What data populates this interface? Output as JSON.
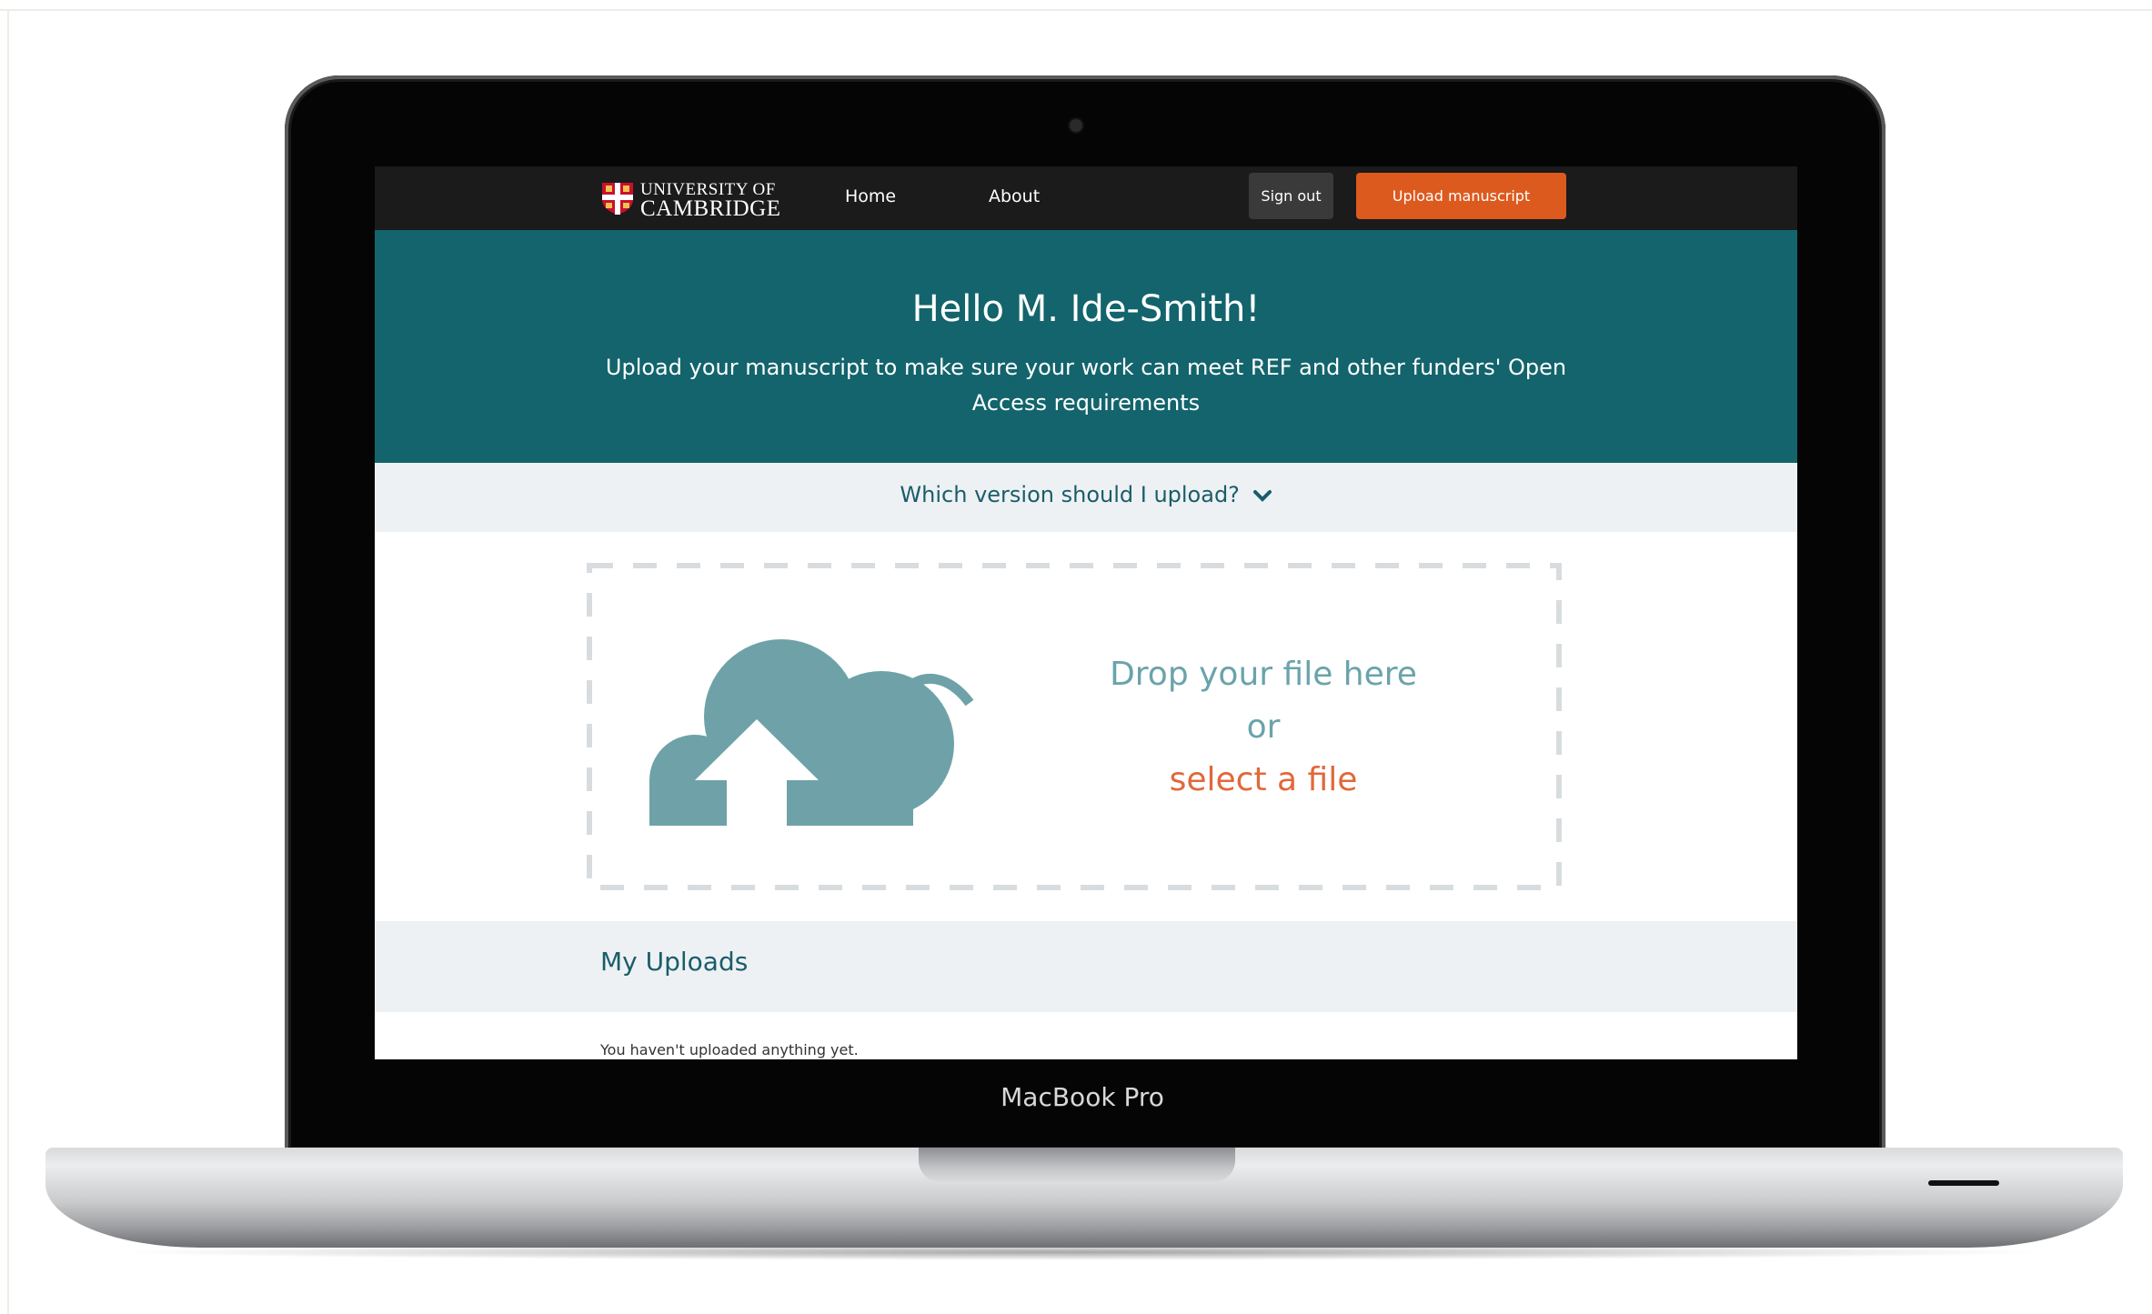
{
  "device": {
    "label": "MacBook Pro"
  },
  "nav": {
    "logo_line1": "UNIVERSITY OF",
    "logo_line2": "CAMBRIDGE",
    "links": [
      {
        "label": "Home"
      },
      {
        "label": "About"
      }
    ],
    "sign_out_label": "Sign out",
    "upload_label": "Upload manuscript"
  },
  "hero": {
    "title": "Hello M. Ide-Smith!",
    "subtitle": "Upload your manuscript to make sure your work can meet REF and other funders' Open Access requirements"
  },
  "version_help": {
    "label": "Which version should I upload?"
  },
  "dropzone": {
    "drop_text": "Drop your file here",
    "or_text": "or",
    "select_text": "select a file"
  },
  "uploads": {
    "title": "My Uploads",
    "empty_message": "You haven't uploaded anything yet."
  },
  "colors": {
    "accent": "#dd5a1f",
    "hero_bg": "#13646c",
    "teal_text": "#1a5d6a",
    "cloud": "#6ea2a8",
    "nav_bg": "#1b1b1b"
  }
}
